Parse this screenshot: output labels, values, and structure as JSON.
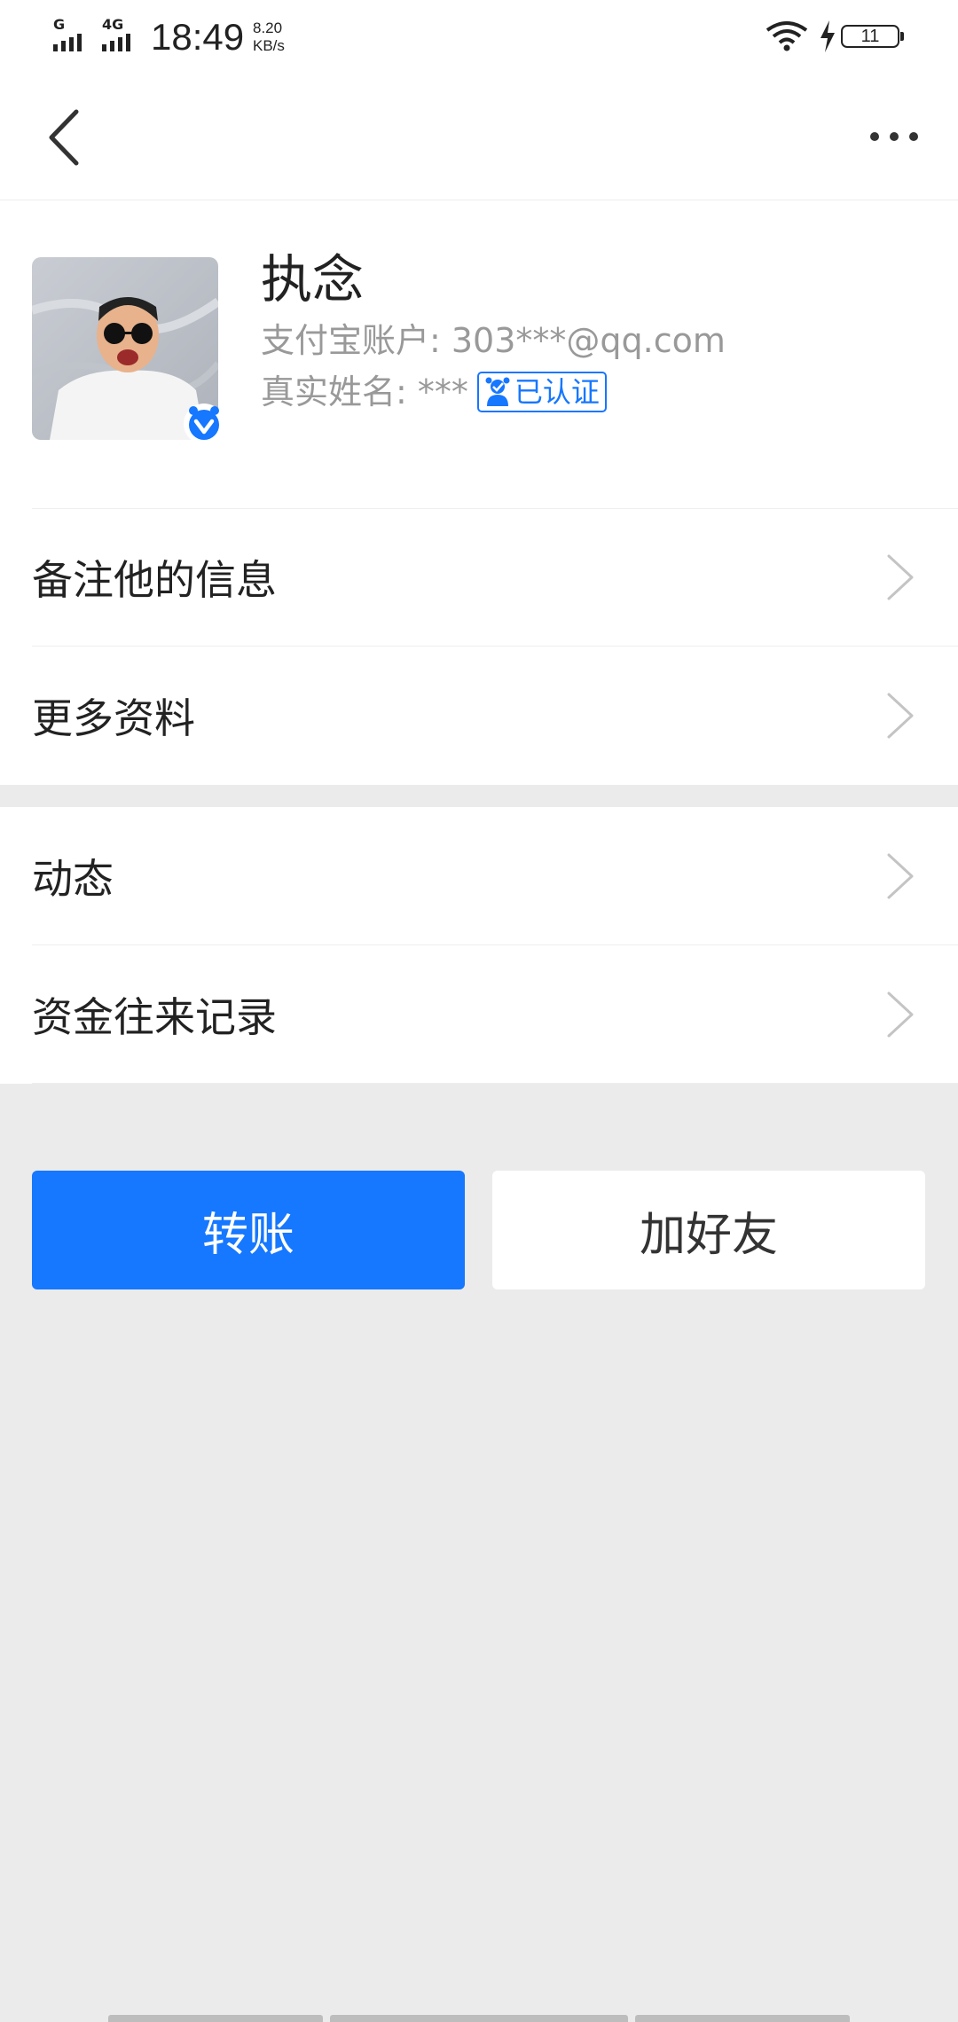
{
  "status_bar": {
    "network_1": "G",
    "network_2": "4G",
    "time": "18:49",
    "speed_value": "8.20",
    "speed_unit": "KB/s",
    "battery": "11",
    "icons": [
      "signal-icon",
      "wifi-icon",
      "charging-icon",
      "battery-icon"
    ]
  },
  "nav": {
    "back_icon": "chevron-left-icon",
    "more_icon": "more-horizontal-icon"
  },
  "profile": {
    "name": "执念",
    "account": "支付宝账户: 303***@qq.com",
    "real_name": "真实姓名: ***",
    "verified_label": "已认证"
  },
  "list_group_1": [
    {
      "label": "备注他的信息"
    },
    {
      "label": "更多资料"
    }
  ],
  "list_group_2": [
    {
      "label": "动态"
    },
    {
      "label": "资金往来记录"
    }
  ],
  "actions": {
    "transfer": "转账",
    "add_friend": "加好友"
  },
  "colors": {
    "accent": "#1677ff",
    "background": "#ebebeb",
    "text_primary": "#222222",
    "text_secondary": "#999999"
  }
}
